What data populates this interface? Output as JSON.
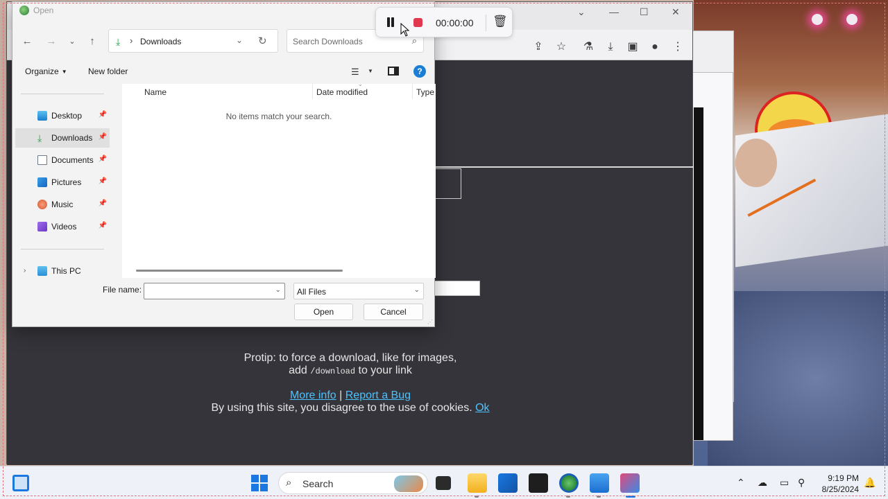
{
  "recording": {
    "time": "00:00:00",
    "pause_icon": "pause-icon",
    "stop_icon": "stop-record-icon",
    "trash_icon": "trash-icon"
  },
  "browser_page": {
    "protip_line1": "Protip: to force a download, like for images,",
    "protip_line2_pre": "add ",
    "protip_code": "/download",
    "protip_line2_post": " to your link",
    "more_info": "More info",
    "separator": "|",
    "report_bug": "Report a Bug",
    "cookie_text": "By using this site, you disagree to the use of cookies.",
    "ok": "Ok",
    "accent_color": "#f2a33a",
    "link_color": "#4bc3ff"
  },
  "dialog": {
    "title": "Open",
    "address": {
      "location": "Downloads",
      "separator": "›"
    },
    "search_placeholder": "Search Downloads",
    "commands": {
      "organize": "Organize",
      "new_folder": "New folder"
    },
    "nav_items": [
      {
        "label": "Desktop"
      },
      {
        "label": "Downloads"
      },
      {
        "label": "Documents"
      },
      {
        "label": "Pictures"
      },
      {
        "label": "Music"
      },
      {
        "label": "Videos"
      },
      {
        "label": "This PC"
      }
    ],
    "selected_nav": "Downloads",
    "columns": {
      "name": "Name",
      "date_modified": "Date modified",
      "type": "Type"
    },
    "empty_message": "No items match your search.",
    "file_name_label": "File name:",
    "file_name_value": "",
    "file_type": "All Files",
    "open_button": "Open",
    "cancel_button": "Cancel"
  },
  "taskbar": {
    "search_label": "Search",
    "time": "9:19 PM",
    "date": "8/25/2024",
    "accent": "#1a78e0"
  }
}
